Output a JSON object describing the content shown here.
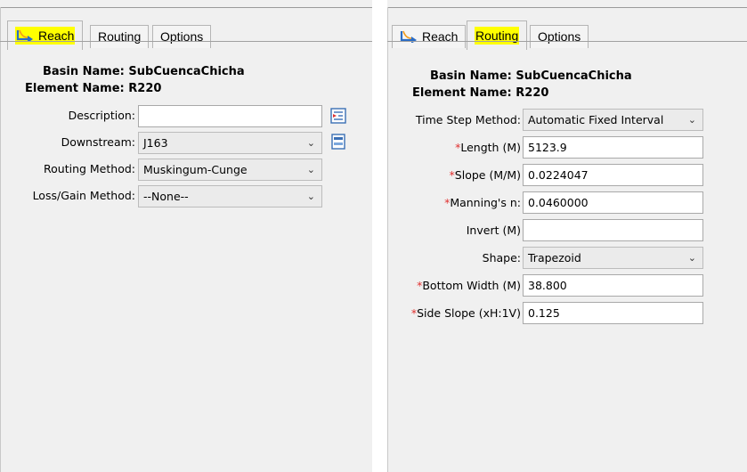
{
  "left": {
    "tabs": [
      {
        "label": "Reach",
        "icon": "reach-icon",
        "active": true,
        "highlighted": true
      },
      {
        "label": "Routing",
        "active": false,
        "highlighted": false
      },
      {
        "label": "Options",
        "active": false,
        "highlighted": false
      }
    ],
    "basin_label": "Basin Name:",
    "basin_value": "SubCuencaChicha",
    "element_label": "Element Name:",
    "element_value": "R220",
    "description": {
      "label": "Description:",
      "value": "",
      "icon": "description-editor-icon"
    },
    "downstream": {
      "label": "Downstream:",
      "value": "J163",
      "icon": "downstream-selector-icon"
    },
    "routing_method": {
      "label": "Routing Method:",
      "value": "Muskingum-Cunge"
    },
    "loss_gain_method": {
      "label": "Loss/Gain Method:",
      "value": "--None--"
    }
  },
  "right": {
    "tabs": [
      {
        "label": "Reach",
        "icon": "reach-icon",
        "active": false,
        "highlighted": false
      },
      {
        "label": "Routing",
        "active": true,
        "highlighted": true
      },
      {
        "label": "Options",
        "active": false,
        "highlighted": false
      }
    ],
    "basin_label": "Basin Name:",
    "basin_value": "SubCuencaChicha",
    "element_label": "Element Name:",
    "element_value": "R220",
    "required_mark": "*",
    "time_step": {
      "label": "Time Step Method:",
      "value": "Automatic Fixed Interval"
    },
    "length": {
      "label": "Length (M)",
      "value": "5123.9",
      "required": true
    },
    "slope": {
      "label": "Slope (M/M)",
      "value": "0.0224047",
      "required": true
    },
    "mannings": {
      "label": "Manning's n:",
      "value": "0.0460000",
      "required": true
    },
    "invert": {
      "label": "Invert (M)",
      "value": "",
      "required": false
    },
    "shape": {
      "label": "Shape:",
      "value": "Trapezoid"
    },
    "bottom_width": {
      "label": "Bottom Width (M)",
      "value": "38.800",
      "required": true
    },
    "side_slope": {
      "label": "Side Slope (xH:1V)",
      "value": "0.125",
      "required": true
    }
  },
  "colors": {
    "highlight": "#ffff00",
    "required": "#e0302f",
    "panel": "#f0f0f0"
  }
}
